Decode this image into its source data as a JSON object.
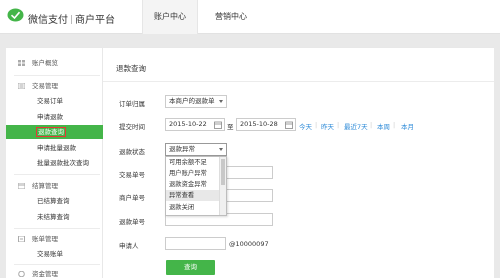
{
  "header": {
    "brand_name": "微信支付",
    "brand_sub": "商户平台",
    "tabs": [
      {
        "label": "账户中心",
        "active": true
      },
      {
        "label": "营销中心",
        "active": false
      }
    ],
    "brand_color": "#44b549"
  },
  "sidebar": {
    "groups": [
      {
        "label": "账户概览",
        "icon": "overview-icon"
      },
      {
        "label": "交易管理",
        "icon": "transaction-icon",
        "items": [
          "交易订单",
          "申请退款",
          "退款查询",
          "申请批量退款",
          "批量退款批次查询"
        ]
      },
      {
        "label": "结算管理",
        "icon": "settlement-icon",
        "items": [
          "已结算查询",
          "未结算查询"
        ]
      },
      {
        "label": "账单管理",
        "icon": "bill-icon",
        "items": [
          "交易账单"
        ]
      },
      {
        "label": "资金管理",
        "icon": "funds-icon"
      }
    ],
    "active_item": "退款查询"
  },
  "main": {
    "title": "退款查询",
    "form": {
      "order_owner_label": "订单归属",
      "order_owner_value": "本商户的退款单",
      "submit_time_label": "提交时间",
      "date_from": "2015-10-22",
      "date_to_sep": "至",
      "date_to": "2015-10-28",
      "quick_ranges": [
        "今天",
        "昨天",
        "最近7天",
        "本周",
        "本月"
      ],
      "refund_status_label": "退款状态",
      "refund_status_value": "退款异常",
      "status_options": [
        "可用余额不足",
        "用户账户异常",
        "退款资金异常",
        "异常查看",
        "退款关闭"
      ],
      "trade_no_label": "交易单号",
      "merchant_no_label": "商户单号",
      "refund_no_label": "退款单号",
      "applicant_label": "申请人",
      "applicant_suffix": "@10000097",
      "query_button": "查询"
    }
  }
}
